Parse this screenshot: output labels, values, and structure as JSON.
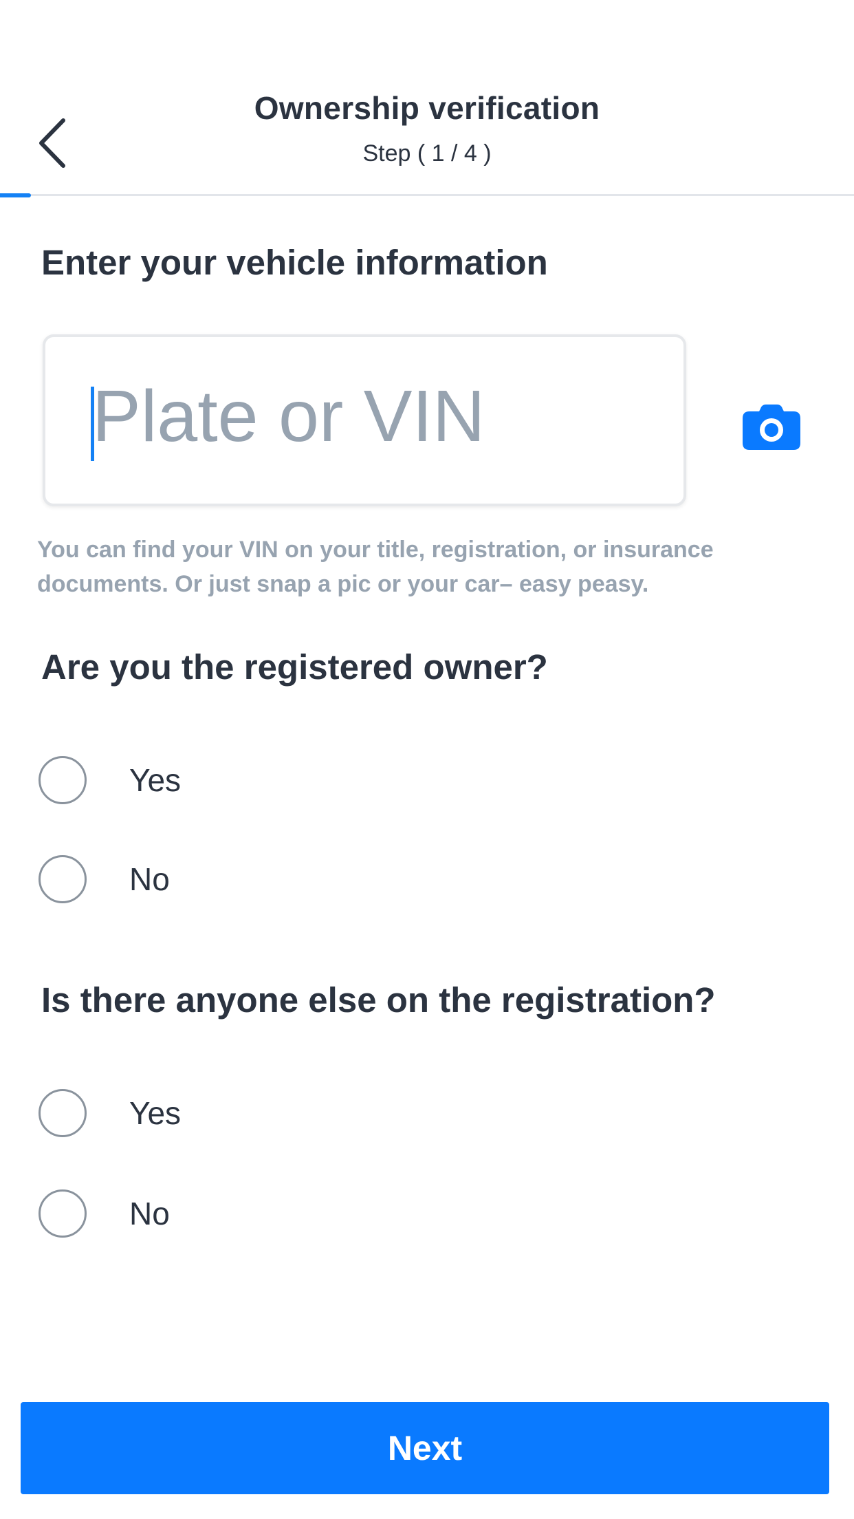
{
  "header": {
    "title": "Ownership verification",
    "step": "Step ( 1 / 4 )",
    "back_icon": "chevron-left-icon"
  },
  "progress": {
    "current_step": 1,
    "total_steps": 4,
    "fill_percent": 3.6,
    "accent_color": "#1481f5"
  },
  "vehicle": {
    "section_title": "Enter your vehicle information",
    "input_value": "",
    "input_placeholder": "Plate or VIN",
    "camera_icon": "camera-icon",
    "hint": "You can find your VIN on your title, registration, or insurance documents. Or just snap a pic or your car– easy peasy."
  },
  "registered_owner": {
    "question": "Are you the registered owner?",
    "options": [
      {
        "label": "Yes",
        "selected": false
      },
      {
        "label": "No",
        "selected": false
      }
    ]
  },
  "other_registrant": {
    "question": "Is there anyone else on the registration?",
    "options": [
      {
        "label": "Yes",
        "selected": false
      },
      {
        "label": "No",
        "selected": false
      }
    ]
  },
  "footer": {
    "next_label": "Next",
    "button_color": "#0a7aff"
  }
}
